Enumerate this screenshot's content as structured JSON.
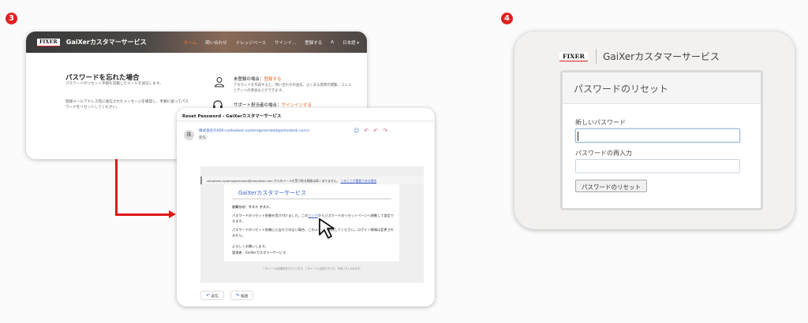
{
  "steps": {
    "step3": "3",
    "step4": "4"
  },
  "portal": {
    "logo": "FIXER",
    "title": "GaiXerカスタマーサービス",
    "nav": [
      "ホーム",
      "問い合わせ",
      "ナレッジベース",
      "サインイ...",
      "登録する",
      "A",
      "日本語 ▾"
    ],
    "forgot_title": "パスワードを忘れた場合",
    "forgot_sub": "パスワードのリセット手順を記載したメールを送信します。",
    "forgot_note": "登録メールアドレス宛に送信されたメッセージを確認し、手順に従ってパスワードをリセットしてください。",
    "register_prefix": "未登録の場合：",
    "register_link": "登録する",
    "register_desc": "アカウントを作成すると、問い合わせの送信、よくある質問の閲覧、コミュニティへの参加などができます。",
    "signin_prefix": "サポート担当者の場合：",
    "signin_link": "サインインする"
  },
  "email": {
    "subject": "Reset Password - GaiXerカスタマーサービス",
    "avatar": "株",
    "sender": "株式会社FIXER<zohodesk-systemgenerated@zohodesk.com>",
    "recipient": "宛先:",
    "notice": "zohodesk-systemgenerated@zohodesk.com からのメールを受け取る頻度は高くありません。",
    "notice_link": "このことが重要である理由",
    "inner_title": "GaiXerカスタマーサービス",
    "greeting": "お知らせ：テスト テスト、",
    "line1_a": "パスワードのリセット依頼を受け付けました。この",
    "line1_link": "リンク",
    "line1_b": "からパスワードのリセットページへ移動して設定できます。",
    "line2": "パスワードのリセット依頼に心当たりのない場合、このメールを無視してください。ログイン情報は変更されません。",
    "closing1": "よろしくお願いします。",
    "closing2": "管理者 - GaiXerカスタマーサービス",
    "footer": "このメールは自動送信されています。このメールに返信されても、対応いたしかねます。",
    "reply": "返信",
    "forward": "転送"
  },
  "reset": {
    "logo": "FIXER",
    "brand": "GaiXerカスタマーサービス",
    "title": "パスワードのリセット",
    "new_password_label": "新しいパスワード",
    "confirm_password_label": "パスワードの再入力",
    "button": "パスワードのリセット"
  },
  "colors": {
    "accent_red": "#e01818",
    "link_blue": "#3b5fc8",
    "orange": "#e66a2a"
  }
}
